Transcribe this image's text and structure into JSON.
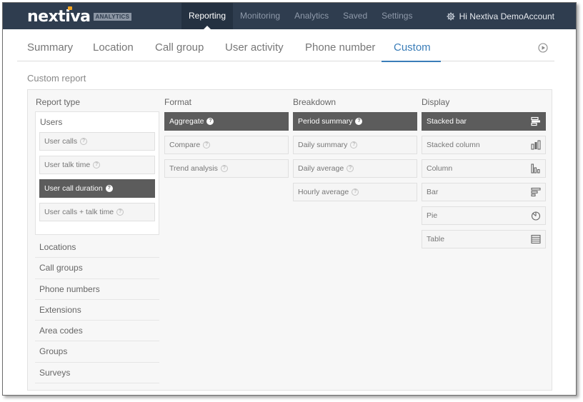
{
  "brand": {
    "logo_text": "nextiva",
    "badge": "ANALYTICS",
    "dot_color": "#f5a623"
  },
  "topnav": {
    "items": [
      "Reporting",
      "Monitoring",
      "Analytics",
      "Saved",
      "Settings"
    ],
    "active_index": 0,
    "account_label": "Hi Nextiva DemoAccount"
  },
  "tabs": {
    "items": [
      "Summary",
      "Location",
      "Call group",
      "User activity",
      "Phone number",
      "Custom"
    ],
    "active_index": 5
  },
  "section_title": "Custom report",
  "columns": {
    "report_type": "Report type",
    "format": "Format",
    "breakdown": "Breakdown",
    "display": "Display"
  },
  "users": {
    "title": "Users",
    "options": [
      "User calls",
      "User talk time",
      "User call duration",
      "User calls + talk time"
    ],
    "active_index": 2
  },
  "report_types": [
    "Locations",
    "Call groups",
    "Phone numbers",
    "Extensions",
    "Area codes",
    "Groups",
    "Surveys"
  ],
  "format": {
    "options": [
      "Aggregate",
      "Compare",
      "Trend analysis"
    ],
    "active_index": 0
  },
  "breakdown": {
    "options": [
      "Period summary",
      "Daily summary",
      "Daily average",
      "Hourly average"
    ],
    "active_index": 0
  },
  "display": {
    "options": [
      "Stacked bar",
      "Stacked column",
      "Column",
      "Bar",
      "Pie",
      "Table"
    ],
    "icons": [
      "stacked-bar-icon",
      "stacked-column-icon",
      "column-icon",
      "bar-icon",
      "pie-icon",
      "table-icon"
    ],
    "active_index": 0
  },
  "colors": {
    "topbar": "#2f3d4f",
    "accent": "#3a7db8",
    "selected": "#5c5c5c"
  }
}
